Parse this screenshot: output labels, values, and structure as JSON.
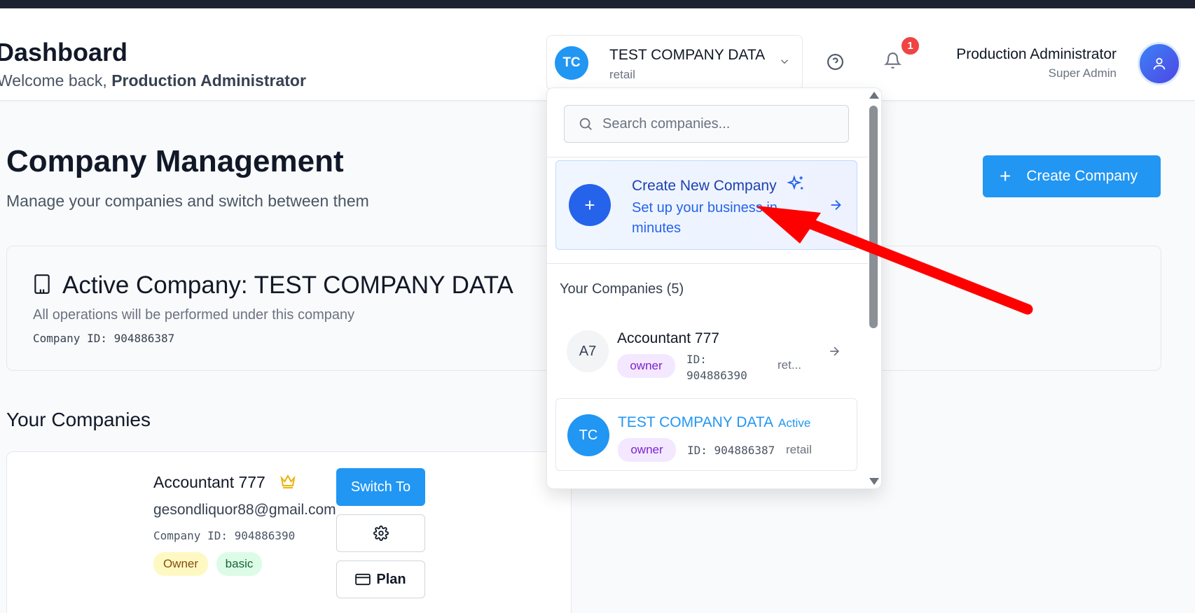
{
  "header": {
    "title": "Dashboard",
    "welcome_prefix": "Welcome back, ",
    "welcome_user": "Production Administrator",
    "company_switcher": {
      "initials": "TC",
      "name": "TEST COMPANY DATA",
      "type": "retail"
    },
    "notification_count": "1",
    "user_name": "Production Administrator",
    "user_role": "Super Admin"
  },
  "page": {
    "title": "Company Management",
    "subtitle": "Manage your companies and switch between them",
    "create_button": "Create Company",
    "create_icon": "+"
  },
  "active_company": {
    "title": "Active Company: TEST COMPANY DATA",
    "description": "All operations will be performed under this company",
    "company_id": "Company ID: 904886387"
  },
  "your_companies": {
    "title": "Your Companies",
    "cards": [
      {
        "name": "Accountant 777",
        "email": "gesondliquor88@gmail.com",
        "company_id": "Company ID: 904886390",
        "role": "Owner",
        "plan": "basic",
        "switch_label": "Switch To",
        "plan_label": "Plan"
      }
    ]
  },
  "dropdown": {
    "search_placeholder": "Search companies...",
    "create_title": "Create New Company",
    "create_subtitle": "Set up your business in minutes",
    "create_icon": "+",
    "list_label": "Your Companies (5)",
    "items": [
      {
        "initials": "A7",
        "name": "Accountant 777",
        "role": "owner",
        "id_label": "ID:",
        "id_value": "904886390",
        "type": "ret..."
      },
      {
        "initials": "TC",
        "name": "TEST COMPANY DATA",
        "active_label": "Active",
        "role": "owner",
        "id_text": "ID: 904886387",
        "type": "retail"
      }
    ]
  },
  "colors": {
    "primary": "#2196f3",
    "annotation_arrow": "#ff0000",
    "badge": "#ef4444"
  }
}
